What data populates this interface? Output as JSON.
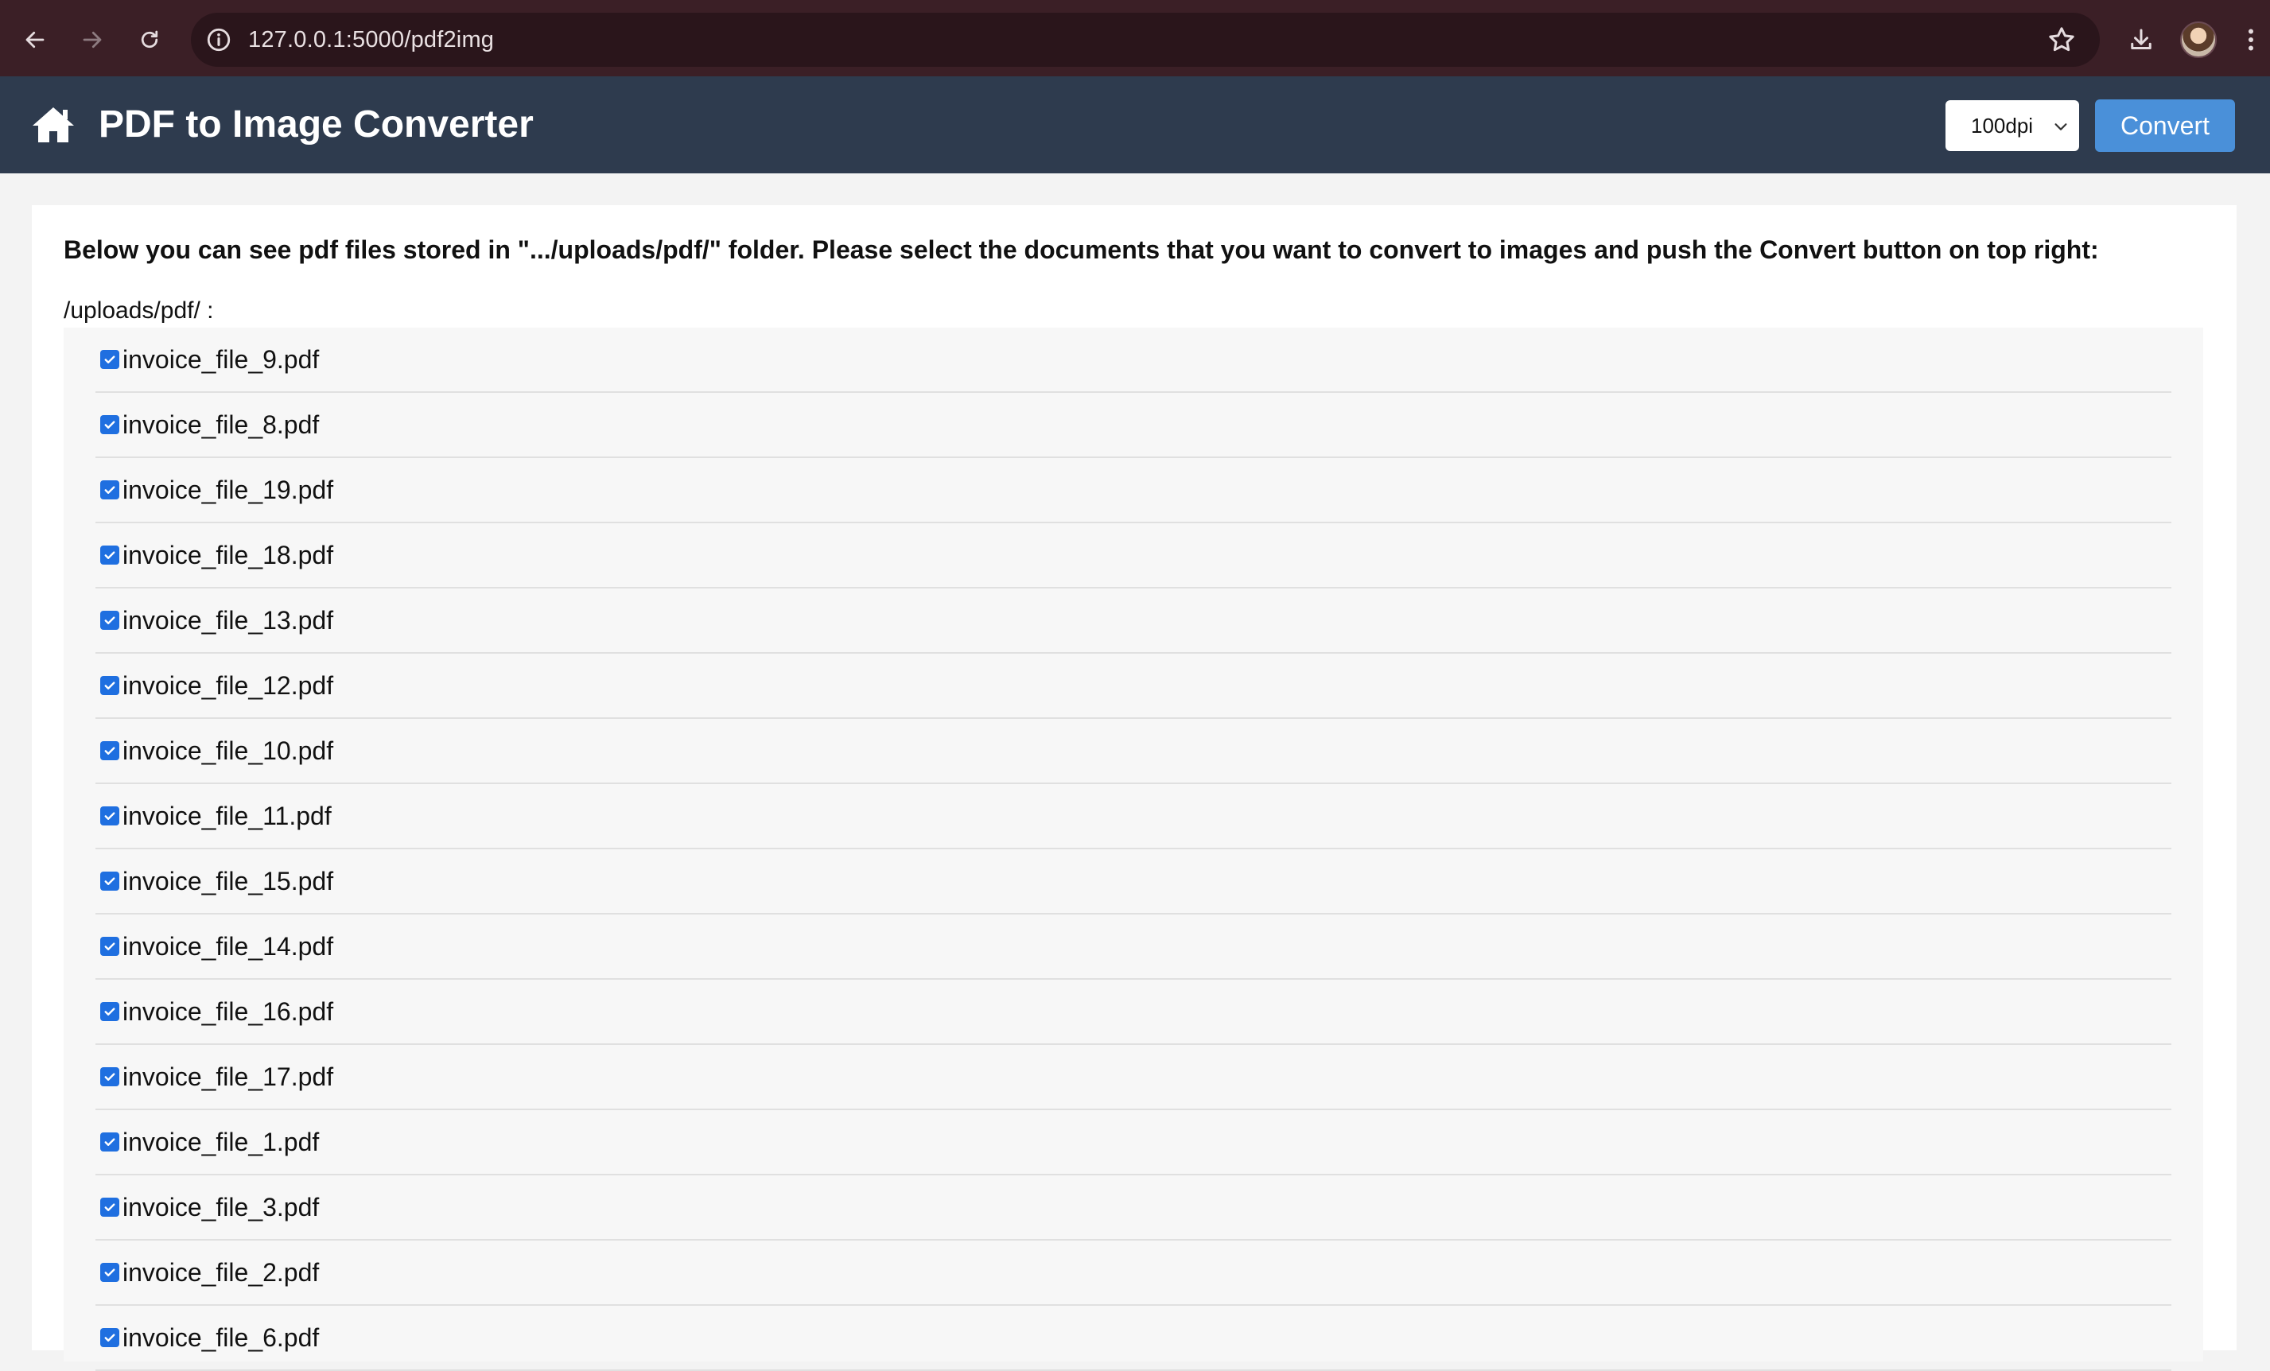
{
  "browser": {
    "url": "127.0.0.1:5000/pdf2img",
    "back_icon": "arrow-left-icon",
    "forward_icon": "arrow-right-icon",
    "reload_icon": "reload-icon",
    "info_icon": "info-icon",
    "bookmark_icon": "star-icon",
    "download_icon": "download-icon",
    "menu_icon": "kebab-menu-icon"
  },
  "header": {
    "title": "PDF to Image Converter",
    "home_icon": "home-icon",
    "dpi_selected": "100dpi",
    "convert_label": "Convert",
    "colors": {
      "header_bg": "#2e3b4e",
      "convert_bg": "#4a90d9"
    }
  },
  "main": {
    "instructions": "Below you can see pdf files stored in \".../uploads/pdf/\" folder. Please select the documents that you want to convert to images and push the Convert button on top right:",
    "folder_label": "/uploads/pdf/ :",
    "files": [
      {
        "name": "invoice_file_9.pdf",
        "checked": true
      },
      {
        "name": "invoice_file_8.pdf",
        "checked": true
      },
      {
        "name": "invoice_file_19.pdf",
        "checked": true
      },
      {
        "name": "invoice_file_18.pdf",
        "checked": true
      },
      {
        "name": "invoice_file_13.pdf",
        "checked": true
      },
      {
        "name": "invoice_file_12.pdf",
        "checked": true
      },
      {
        "name": "invoice_file_10.pdf",
        "checked": true
      },
      {
        "name": "invoice_file_11.pdf",
        "checked": true
      },
      {
        "name": "invoice_file_15.pdf",
        "checked": true
      },
      {
        "name": "invoice_file_14.pdf",
        "checked": true
      },
      {
        "name": "invoice_file_16.pdf",
        "checked": true
      },
      {
        "name": "invoice_file_17.pdf",
        "checked": true
      },
      {
        "name": "invoice_file_1.pdf",
        "checked": true
      },
      {
        "name": "invoice_file_3.pdf",
        "checked": true
      },
      {
        "name": "invoice_file_2.pdf",
        "checked": true
      },
      {
        "name": "invoice_file_6.pdf",
        "checked": true
      }
    ]
  }
}
